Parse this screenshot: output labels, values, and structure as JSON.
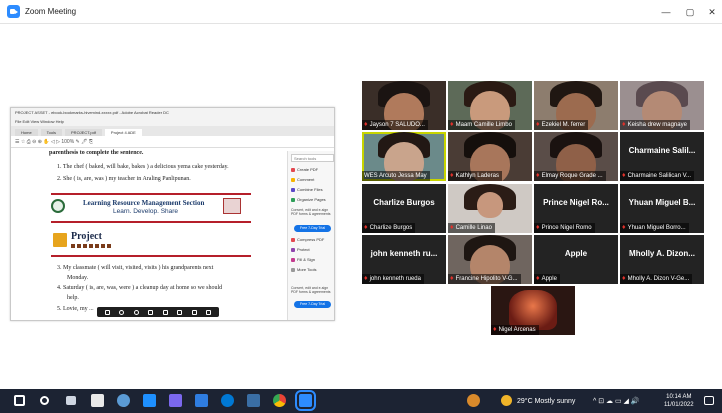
{
  "window": {
    "title": "Zoom Meeting",
    "minimize": "—",
    "maximize": "▢",
    "close": "✕"
  },
  "share": {
    "window_title": "PROJECT ASSET - ebook-bookmarks-hivemind-xxxxx.pdf - Adobe Acrobat Reader DC",
    "menu": "File  Edit  View  Window  Help",
    "tabs": [
      "Home",
      "Tools",
      "PROJECT.pdf",
      "Project 4 ADE"
    ],
    "toolbar": "☰  ☆  ⎙  ⊖  ⊕   ✋   ◁  ▷   100%   ✎  🖊  ⎘",
    "doc": {
      "instructions_1": "parenthesis to complete the sentence.",
      "item_1": "1.  The chef ( baked, will bake, bakes ) a delicious yema cake yesterday.",
      "item_2": "2.  She ( is, are, was ) my teacher in Araling Panlipunan.",
      "banner_title": "Learning Resource Management Section",
      "banner_subtitle": "Learn. Develop. Share",
      "project_title": "Project",
      "item_3": "3.  My classmate ( will visit, visited, visits ) his grandparents next",
      "item_3b": "Monday.",
      "item_4": "4.  Saturday ( is, are, was, were ) a cleanup day at home so we should",
      "item_4b": "help.",
      "item_5": "5.  Lovie, my ..."
    },
    "side_panel": {
      "search": "Search tools",
      "items": [
        "Create PDF",
        "Comment",
        "Combine Files",
        "Organize Pages",
        "Compress PDF",
        "Protect",
        "Fill & Sign",
        "More Tools"
      ],
      "promo": "Convert, edit and e-sign PDF forms & agreements",
      "button": "Free 7-Day Trial"
    }
  },
  "participants": [
    {
      "name": "Jayson 7 SALUDO..."
    },
    {
      "name": "Maam Camille Limbo"
    },
    {
      "name": "Ezekiel M. ferrer"
    },
    {
      "name": "Keisha drew magnaye"
    },
    {
      "name": "WES Arcuto Jessa May"
    },
    {
      "name": "Kathlyn Laderas"
    },
    {
      "name": "Elmay Roque Grade ..."
    },
    {
      "name": "Charmaine Salilican V..."
    },
    {
      "name": "Charlize Burgos"
    },
    {
      "name": "Camille Linao"
    },
    {
      "name": "Prince Nigel Romo"
    },
    {
      "name": "Yhuan Miguel Borro..."
    },
    {
      "name": "john kenneth rueda"
    },
    {
      "name": "Francine Hipolito V-G..."
    },
    {
      "name": "Apple"
    },
    {
      "name": "Mholly A. Dizon V-Ge..."
    },
    {
      "name": "Nigel Arcenas"
    }
  ],
  "name_cards": {
    "charmaine": "Charmaine Salil...",
    "charlize": "Charlize Burgos",
    "prince": "Prince Nigel Ro...",
    "yhuan": "Yhuan Miguel B...",
    "john": "john kenneth ru...",
    "apple": "Apple",
    "mholly": "Mholly A. Dizon..."
  },
  "taskbar": {
    "weather": "29°C  Mostly sunny",
    "time": "10:14 AM",
    "date": "11/01/2022",
    "tray_icons": "^  ⊡  ☁  ▭  ◢  🔊"
  },
  "colors": {
    "active_speaker": "#c8d400",
    "muted_mic": "#e0312b",
    "taskbar": "#1c2333",
    "zoom_blue": "#2d8cff"
  }
}
